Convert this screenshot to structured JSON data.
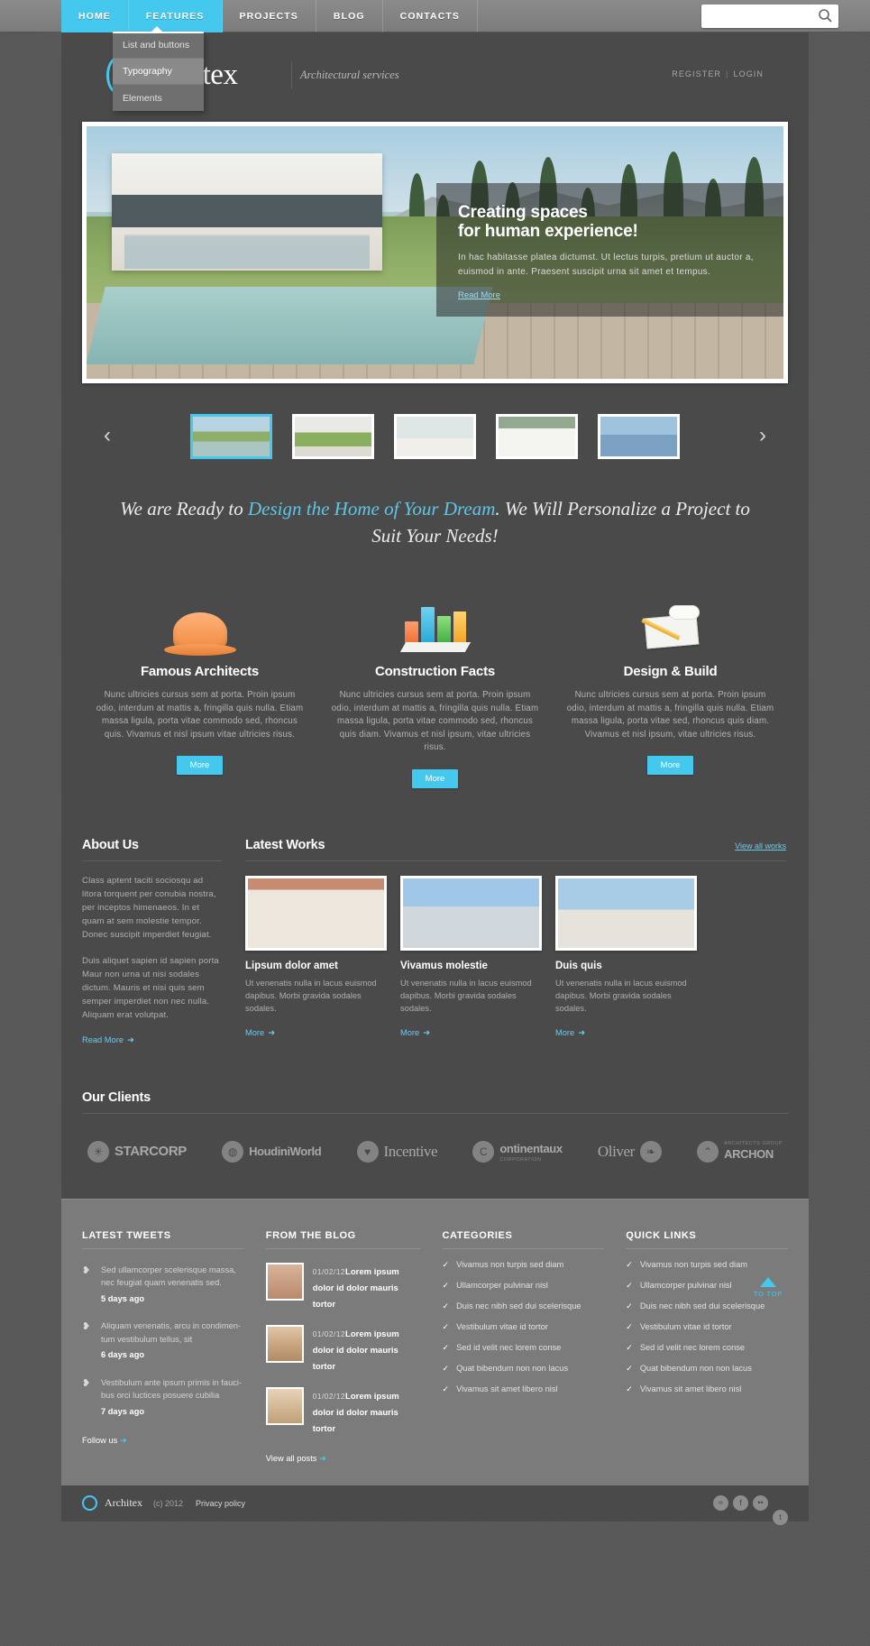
{
  "nav": {
    "items": [
      {
        "label": "HOME",
        "active": true
      },
      {
        "label": "FEATURES",
        "active": true
      },
      {
        "label": "PROJECTS",
        "active": false
      },
      {
        "label": "BLOG",
        "active": false
      },
      {
        "label": "CONTACTS",
        "active": false
      }
    ],
    "dropdown": [
      {
        "label": "List and buttons"
      },
      {
        "label": "Typography"
      },
      {
        "label": "Elements"
      }
    ],
    "search_placeholder": "",
    "search_value": ""
  },
  "header": {
    "logo_text": "Architex",
    "tagline": "Architectural services",
    "register": "REGISTER",
    "separator": "|",
    "login": "LOGIN"
  },
  "slider": {
    "caption_line1": "Creating spaces",
    "caption_line2": "for human experience!",
    "caption_body": "In hac habitasse platea dictumst. Ut lectus turpis, pretium ut auctor a, euismod in ante. Praesent suscipit urna sit amet et tempus.",
    "read_more": "Read More",
    "prev": "‹",
    "next": "›",
    "thumbs": [
      {
        "name": "thumb-1",
        "selected": true
      },
      {
        "name": "thumb-2",
        "selected": false
      },
      {
        "name": "thumb-3",
        "selected": false
      },
      {
        "name": "thumb-4",
        "selected": false
      },
      {
        "name": "thumb-5",
        "selected": false
      }
    ]
  },
  "tagline_block": {
    "before": "We are Ready to ",
    "highlight": "Design the Home of Your Dream",
    "after": ". We Will Personalize a Project to Suit Your Needs!",
    "highlight_color": "#5cc7e8"
  },
  "features": [
    {
      "icon": "hard-hat-icon",
      "title": "Famous Architects",
      "body": "Nunc ultricies cursus sem at porta. Proin ipsum odio, interdum at mattis a, fringilla quis nulla. Etiam massa ligula, porta vitae commodo sed, rhoncus quis. Vivamus et nisl ipsum vitae ultricies risus.",
      "button": "More"
    },
    {
      "icon": "bar-chart-icon",
      "title": "Construction Facts",
      "body": "Nunc ultricies cursus sem at porta. Proin ipsum odio, interdum at mattis a, fringilla quis nulla. Etiam massa ligula, porta vitae commodo sed, rhoncus quis diam. Vivamus et nisl ipsum, vitae ultricies risus.",
      "button": "More"
    },
    {
      "icon": "blueprint-pencil-icon",
      "title": "Design & Build",
      "body": "Nunc ultricies cursus sem at porta. Proin ipsum odio, interdum at mattis a, fringilla quis nulla. Etiam massa ligula, porta vitae sed, rhoncus quis diam. Vivamus et nisl ipsum, vitae ultricies risus.",
      "button": "More"
    }
  ],
  "about": {
    "title": "About Us",
    "p1": "Class aptent taciti sociosqu ad litora torquent per conubia nostra, per inceptos himenaeos. In et quam at sem molestie tempor. Donec suscipit imperdiet feugiat.",
    "p2": "Duis aliquet sapien id sapien porta Maur non urna ut nisi sodales dictum. Mauris et nisi quis sem semper imperdiet non nec nulla. Aliquam erat volutpat.",
    "link": "Read More",
    "arrow": "➜"
  },
  "works": {
    "title": "Latest Works",
    "view_all": "View all works",
    "items": [
      {
        "title": "Lipsum dolor amet",
        "body": "Ut venenatis nulla in lacus euismod dapibus. Morbi gravida sodales sodales.",
        "link": "More",
        "arrow": "➜"
      },
      {
        "title": "Vivamus molestie",
        "body": "Ut venenatis nulla in lacus euismod dapibus. Morbi gravida sodales sodales.",
        "link": "More",
        "arrow": "➜"
      },
      {
        "title": "Duis quis",
        "body": "Ut venenatis nulla in lacus euismod dapibus. Morbi gravida sodales sodales.",
        "link": "More",
        "arrow": "➜"
      }
    ]
  },
  "clients": {
    "title": "Our Clients",
    "items": [
      {
        "name": "STARCORP",
        "sub": ""
      },
      {
        "name": "HoudiniWorld",
        "sub": ""
      },
      {
        "name": "Incentive",
        "sub": ""
      },
      {
        "name": "ontinentaux",
        "sub": "CORPORATION"
      },
      {
        "name": "Oliver",
        "sub": ""
      },
      {
        "name": "ARCHON",
        "sub": "ARCHITECTS GROUP"
      }
    ]
  },
  "footer": {
    "tweets": {
      "title": "LATEST TWEETS",
      "items": [
        {
          "text": "Sed ullamcorper scelerisque massa, nec feugiat quam venenatis sed.",
          "time": "5 days ago"
        },
        {
          "text": "Aliquam venenatis, arcu in condimen-tum vestibulum tellus, sit",
          "time": "6 days ago"
        },
        {
          "text": "Vestibulum ante ipsum primis in fauci-bus orci luctices posuere cubilia",
          "time": "7 days ago"
        }
      ],
      "link": "Follow us",
      "arrow": "➜"
    },
    "blog": {
      "title": "FROM THE BLOG",
      "items": [
        {
          "date": "01/02/12",
          "title": "Lorem ipsum dolor id dolor mauris tortor"
        },
        {
          "date": "01/02/12",
          "title": "Lorem ipsum dolor id dolor mauris tortor"
        },
        {
          "date": "01/02/12",
          "title": "Lorem ipsum dolor id dolor mauris tortor"
        }
      ],
      "link": "View all posts",
      "arrow": "➜"
    },
    "categories": {
      "title": "CATEGORIES",
      "items": [
        "Vivamus non turpis sed diam",
        "Ullamcorper pulvinar nisl",
        "Duis nec nibh sed dui scelerisque",
        "Vestibulum vitae id tortor",
        "Sed id velit nec lorem conse",
        "Quat bibendum non non lacus",
        "Vivamus sit amet libero nisl"
      ]
    },
    "quicklinks": {
      "title": "QUICK LINKS",
      "items": [
        "Vivamus non turpis sed diam",
        "Ullamcorper pulvinar nisl",
        "Duis nec nibh sed dui scelerisque",
        "Vestibulum vitae id tortor",
        "Sed id velit nec lorem conse",
        "Quat bibendum non non lacus",
        "Vivamus sit amet libero nisl"
      ]
    },
    "to_top": "TO TOP"
  },
  "bottom": {
    "brand": "Architex",
    "copyright": "(c) 2012",
    "privacy": "Privacy policy",
    "socials": [
      "rss-icon",
      "facebook-icon",
      "flickr-icon",
      "twitter-icon"
    ]
  },
  "colors": {
    "accent": "#45c8ee",
    "bg": "#4a4a4a",
    "footer": "#7b7b7b"
  }
}
